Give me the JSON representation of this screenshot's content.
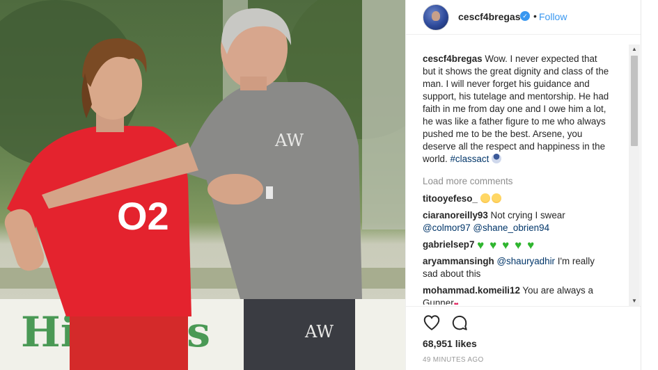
{
  "post": {
    "photo_alt": "Two men on a training pitch, an older man in a grey training shirt gesturing to a young player in a red shirt",
    "shirt_sponsor": "O2",
    "shirt_initials": "AW",
    "banner_text": "Hi  ft F  s"
  },
  "header": {
    "username": "cescf4bregas",
    "verified_glyph": "✓",
    "separator": "•",
    "follow_label": "Follow"
  },
  "caption": {
    "username": "cescf4bregas",
    "text": "Wow. I never expected that but it shows the great dignity and class of the man. I will never forget his guidance and support, his tutelage and mentorship. He had faith in me from day one and I owe him a lot, he was like a father figure to me who always pushed me to be the best. Arsene, you deserve all the respect and happiness in the world.",
    "hashtag": "#classact"
  },
  "load_more_label": "Load more comments",
  "comments": [
    {
      "username": "titooyefeso_",
      "text": ""
    },
    {
      "username": "ciaranoreilly93",
      "text": "Not crying I swear",
      "mentions": "@colmor97 @shane_obrien94"
    },
    {
      "username": "gabrielsep7",
      "text": ""
    },
    {
      "username": "aryammansingh",
      "mention": "@shauryadhir",
      "text": "I'm really sad about this"
    },
    {
      "username": "mohammad.komeili12",
      "text": "You are always a Gunner"
    }
  ],
  "scroll": {
    "up_glyph": "▲",
    "down_glyph": "▼"
  },
  "actions": {
    "likes": "68,951 likes",
    "timestamp": "49 MINUTES AGO"
  },
  "colors": {
    "link_blue": "#3897f0",
    "hashtag": "#003569",
    "arsenal_red": "#e4232e",
    "training_grey": "#8a8a88"
  }
}
